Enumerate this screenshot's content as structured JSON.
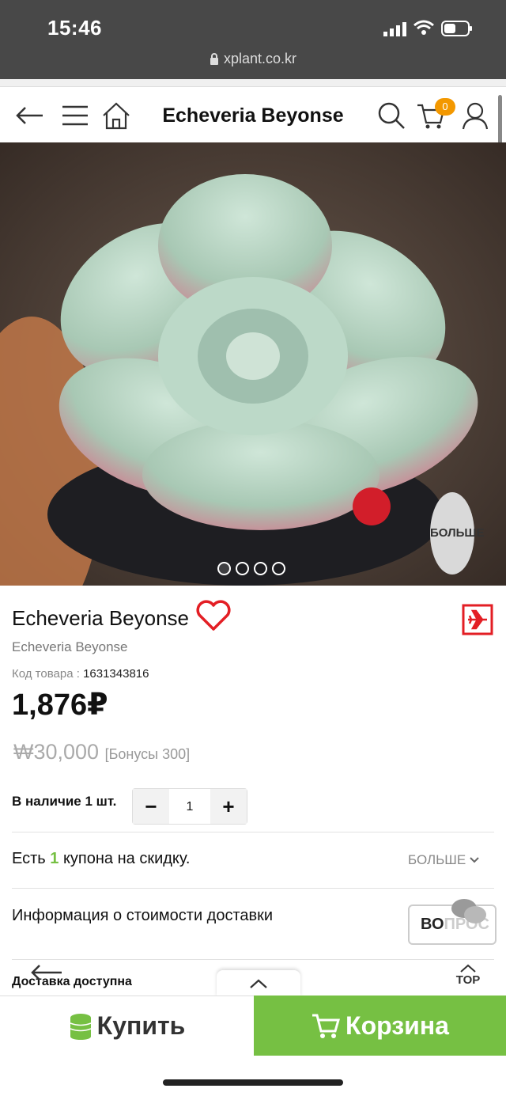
{
  "status_bar": {
    "time": "15:46",
    "url": "xplant.co.kr"
  },
  "header": {
    "title": "Echeveria Beyonse",
    "cart_count": "0"
  },
  "gallery": {
    "more_label": "БОЛЬШЕ",
    "slide_count": 4,
    "active_slide": 1
  },
  "product": {
    "name": "Echeveria Beyonse",
    "subname": "Echeveria Beyonse",
    "code_label": "Код товара :",
    "code_value": "1631343816",
    "price": "1,876₽",
    "original_price": "₩30,000",
    "bonus": "[Бонусы 300]",
    "stock": "В наличие 1 шт.",
    "quantity": "1",
    "minus": "−",
    "plus": "+"
  },
  "coupon": {
    "prefix": "Есть ",
    "count": "1",
    "suffix": " купона на скидку.",
    "more": "БОЛЬШЕ"
  },
  "shipping": {
    "label": "Информация о стоимости доставки",
    "question_a": "ВО",
    "question_b": "ПРОС"
  },
  "delivery": {
    "label": "Доставка доступна"
  },
  "top_button": "TOP",
  "actions": {
    "buy": "Купить",
    "cart": "Корзина"
  },
  "colors": {
    "accent": "#76c043",
    "badge": "#f39800",
    "heart": "#e31e24"
  }
}
